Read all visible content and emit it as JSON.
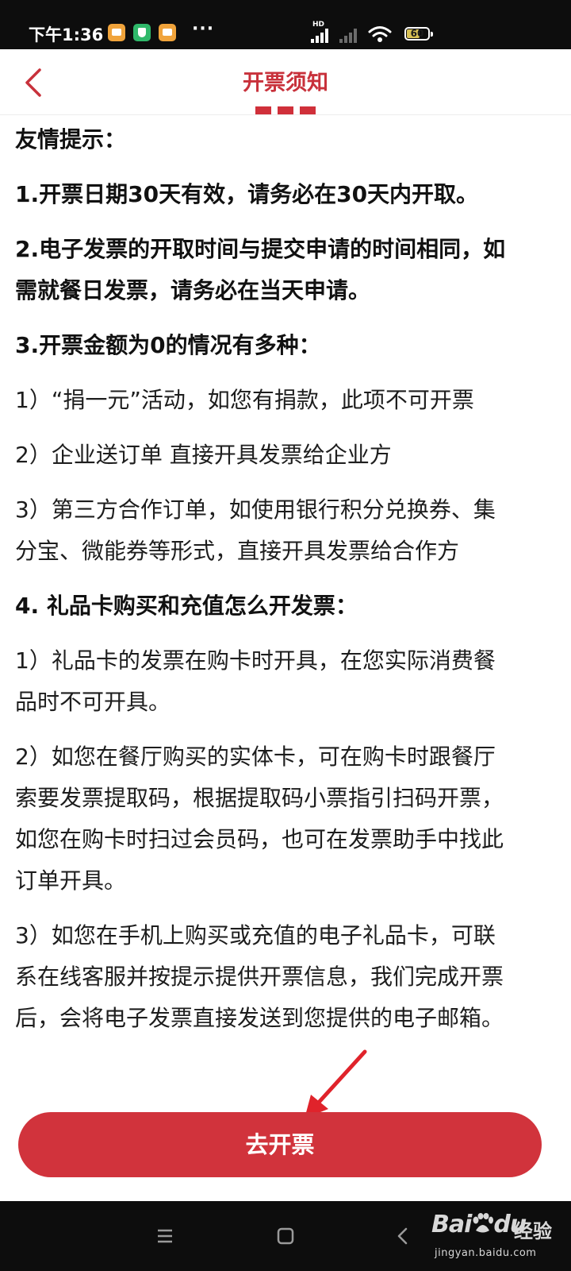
{
  "status_bar": {
    "time": "下午1:36",
    "more": "···",
    "hd_label": "HD",
    "battery": "60",
    "battery_level": 0.6,
    "icons": [
      "notification-app-icon",
      "shield-app-icon",
      "notification-app-icon",
      "signal-icon",
      "signal-weak-icon",
      "wifi-icon",
      "battery-icon"
    ]
  },
  "header": {
    "title": "开票须知",
    "accent_color": "#c8313b"
  },
  "content": {
    "heading": "友情提示：",
    "item1": "1.开票日期30天有效，请务必在30天内开取。",
    "item2_line1": "2.电子发票的开取时间与提交申请的时间相同，如",
    "item2_line2": "需就餐日发票，请务必在当天申请。",
    "item3_title": "3.开票金额为0的情况有多种：",
    "item3_sub1": "1）“捐一元”活动，如您有捐款，此项不可开票",
    "item3_sub2": "2）企业送订单  直接开具发票给企业方",
    "item3_sub3_line1": "3）第三方合作订单，如使用银行积分兑换券、集",
    "item3_sub3_line2": "分宝、微能券等形式，直接开具发票给合作方",
    "item4_title": "4. 礼品卡购买和充值怎么开发票：",
    "item4_sub1_line1": "1）礼品卡的发票在购卡时开具，在您实际消费餐",
    "item4_sub1_line2": "品时不可开具。",
    "item4_sub2_line1": "2）如您在餐厅购买的实体卡，可在购卡时跟餐厅",
    "item4_sub2_line2": "索要发票提取码，根据提取码小票指引扫码开票，",
    "item4_sub2_line3": "如您在购卡时扫过会员码，也可在发票助手中找此",
    "item4_sub2_line4": "订单开具。",
    "item4_sub3_line1": "3）如您在手机上购买或充值的电子礼品卡，可联",
    "item4_sub3_line2": "系在线客服并按提示提供开票信息，我们完成开票",
    "item4_sub3_line3": "后，会将电子发票直接发送到您提供的电子邮箱。"
  },
  "cta": {
    "label": "去开票",
    "color": "#d1333c"
  },
  "nav_bar": {
    "buttons": [
      "menu-icon",
      "home-icon",
      "back-icon"
    ]
  },
  "watermark": {
    "logo": "Bai",
    "logo_suffix": "du",
    "jingyan": "经验",
    "url": "jingyan.baidu.com"
  }
}
